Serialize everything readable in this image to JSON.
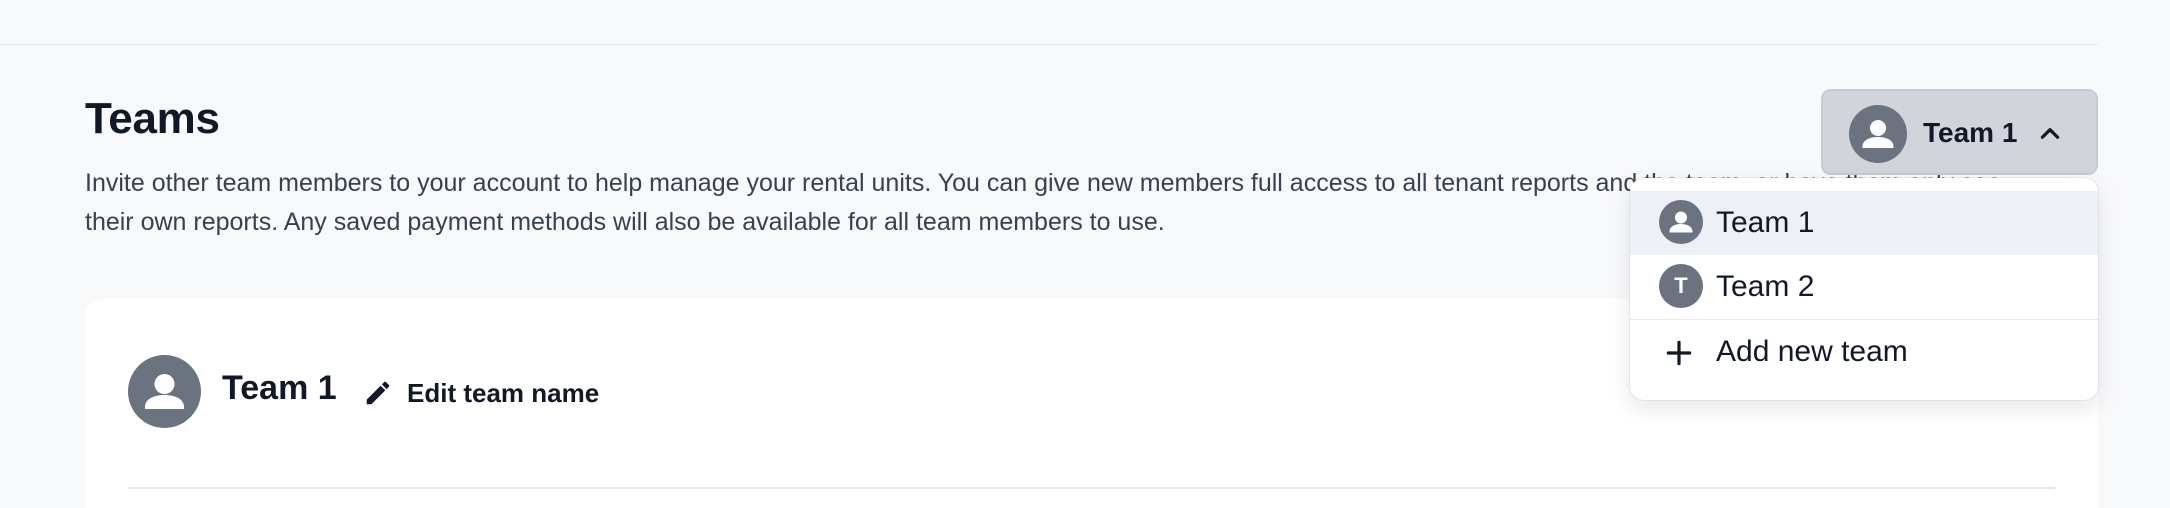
{
  "page": {
    "title": "Teams",
    "description": "Invite other team members to your account to help manage your rental units. You can give new members full access to all tenant reports and the team, or have them only see their own reports. Any saved payment methods will also be available for all team members to use."
  },
  "team_card": {
    "team_name": "Team 1",
    "edit_label": "Edit team name",
    "avatar_icon": "user-icon"
  },
  "team_selector": {
    "selected": "Team 1",
    "avatar_icon": "user-icon",
    "chevron_icon": "chevron-up-icon",
    "expanded": true
  },
  "dropdown": {
    "items": [
      {
        "label": "Team 1",
        "icon": "user-icon",
        "active": true
      },
      {
        "label": "Team 2",
        "icon": "letter-avatar",
        "letter": "T",
        "active": false
      }
    ],
    "add_label": "Add new team",
    "add_icon": "plus-icon"
  },
  "colors": {
    "background": "#f8f9fb",
    "avatar": "#6b7280",
    "selector_bg": "#d1d5db",
    "active_item": "#eef0f7"
  }
}
